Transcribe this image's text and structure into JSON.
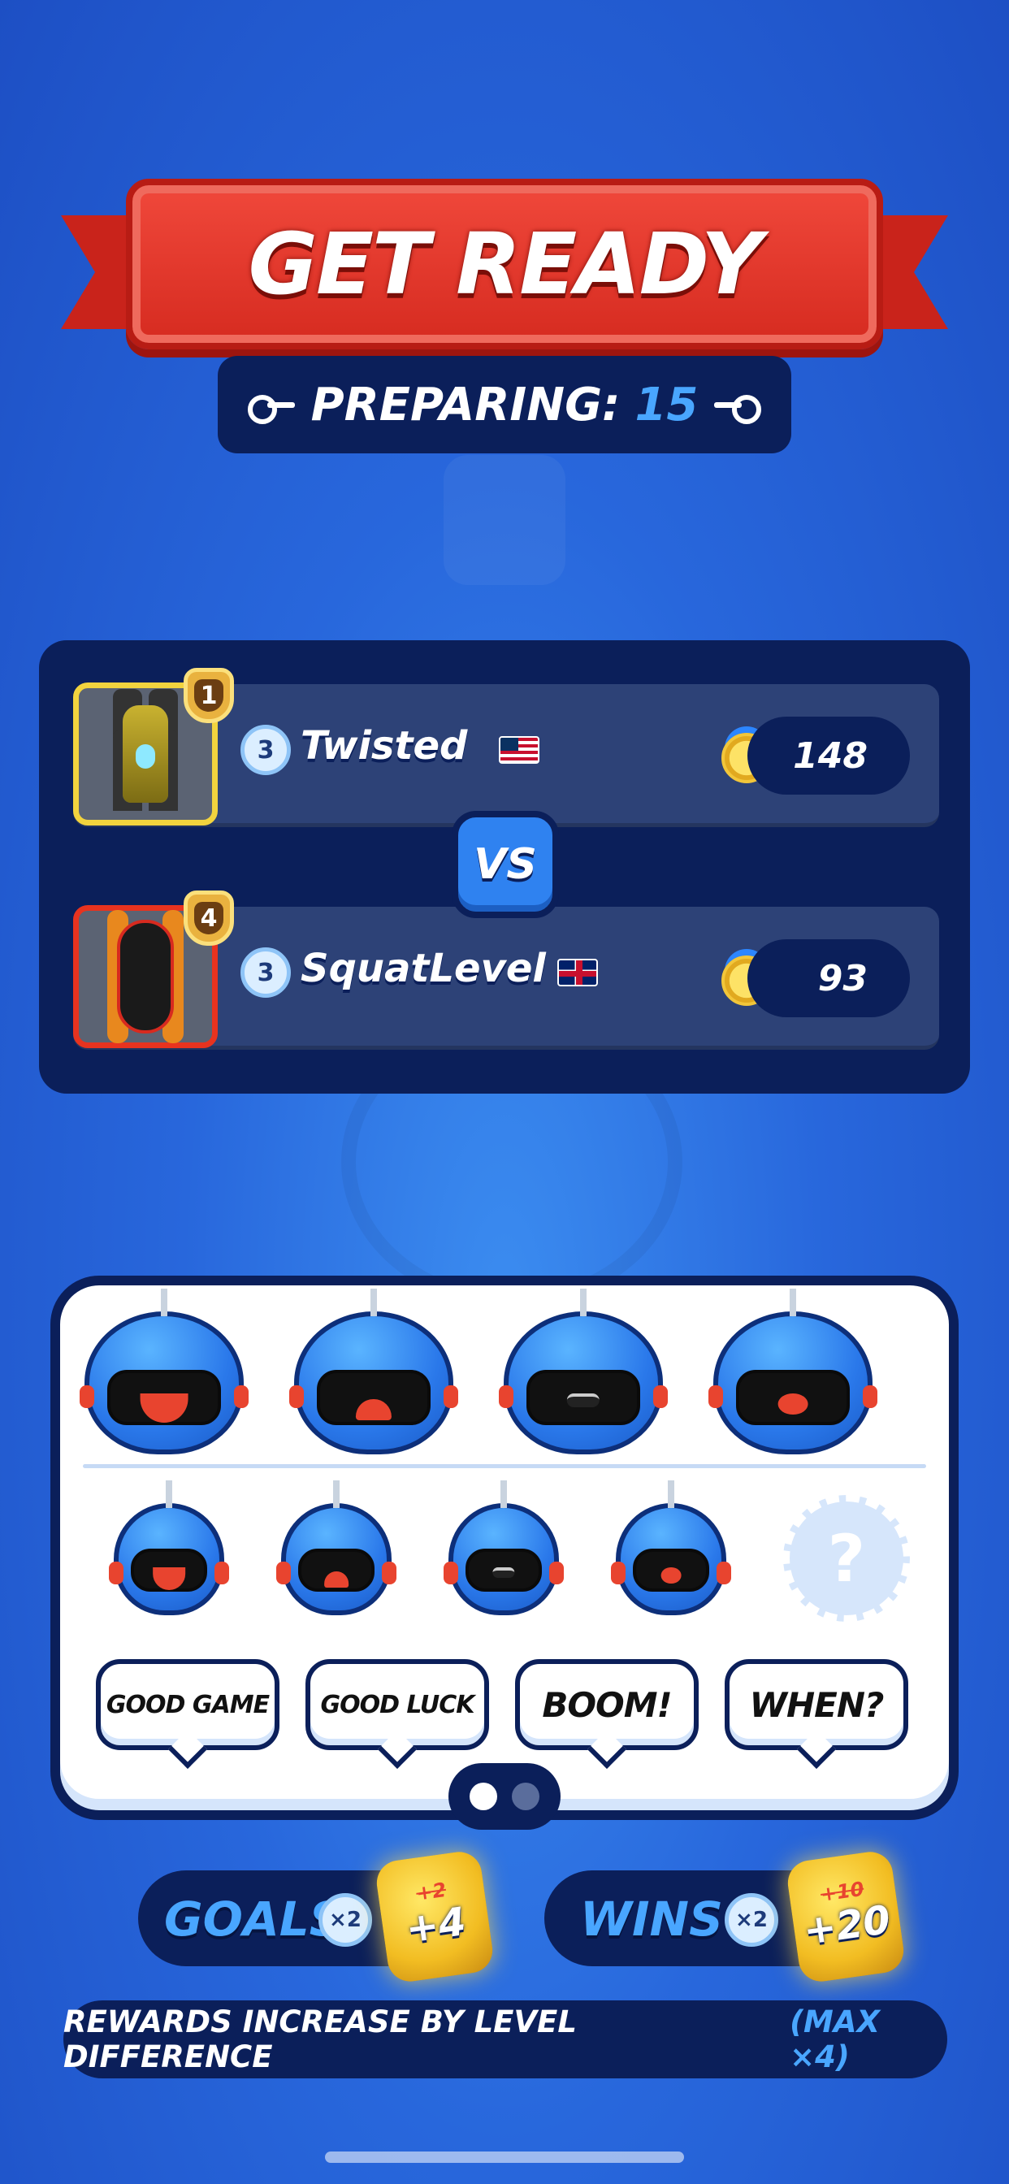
{
  "header": {
    "title": "GET READY",
    "preparing_label": "PREPARING:",
    "preparing_count": "15"
  },
  "match": {
    "vs_label": "VS",
    "players": [
      {
        "rank": "1",
        "level": "3",
        "name": "Twisted",
        "flag": "US",
        "trophies": "148",
        "frame_color": "#f2d33e"
      },
      {
        "rank": "4",
        "level": "3",
        "name": "SquatLevel",
        "flag": "UK",
        "trophies": "93",
        "frame_color": "#e8331f"
      }
    ]
  },
  "emotes": {
    "large": [
      "laughing-face",
      "crying-face",
      "smirk-face",
      "shocked-face"
    ],
    "small": [
      "laughing-face",
      "crying-face",
      "smirk-face",
      "shocked-face"
    ],
    "locked_symbol": "?",
    "phrases": [
      "GOOD GAME",
      "GOOD LUCK",
      "BOOM!",
      "WHEN?"
    ],
    "page_active": 1,
    "page_count": 2
  },
  "rewards": {
    "goals": {
      "label": "GOALS",
      "multiplier": "×2",
      "old_value": "+2",
      "new_value": "+4"
    },
    "wins": {
      "label": "WINS",
      "multiplier": "×2",
      "old_value": "+10",
      "new_value": "+20"
    },
    "info_text": "REWARDS INCREASE BY LEVEL DIFFERENCE",
    "info_highlight": "(MAX ×4)"
  },
  "colors": {
    "background": "#2867dc",
    "panel_navy": "#0b1f5a",
    "accent_blue": "#49a6ff",
    "banner_red": "#d62b20"
  }
}
